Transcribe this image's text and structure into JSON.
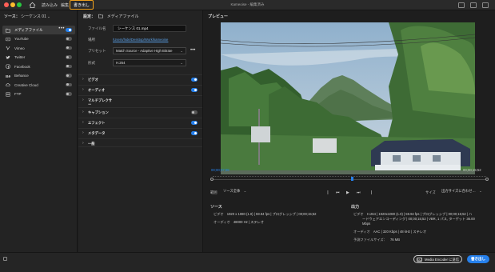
{
  "titlebar": {
    "tabs": [
      {
        "label": "読み込み"
      },
      {
        "label": "編集"
      },
      {
        "label": "書き出し"
      }
    ],
    "app_title": "Kameoise - 編集済み"
  },
  "left": {
    "source_label": "ソース：",
    "source_value": "シーケンス 01",
    "destinations": [
      {
        "label": "メディアファイル",
        "enabled": true
      },
      {
        "label": "YouTube",
        "enabled": false
      },
      {
        "label": "Vimeo",
        "enabled": false
      },
      {
        "label": "Twitter",
        "enabled": false
      },
      {
        "label": "Facebook",
        "enabled": false
      },
      {
        "label": "Behance",
        "enabled": false
      },
      {
        "label": "Creative Cloud",
        "enabled": false
      },
      {
        "label": "FTP",
        "enabled": false
      }
    ]
  },
  "settings": {
    "header": "設定：",
    "header_target": "メディアファイル",
    "filename_label": "ファイル名",
    "filename_value": "シーケンス 01.mp4",
    "location_label": "場所",
    "location_value": "/Users/hide/Desktop/Work/kameoise",
    "preset_label": "プリセット",
    "preset_value": "Match Source - Adaptive High Bitrate",
    "format_label": "形式",
    "format_value": "H.264",
    "sections": [
      {
        "label": "ビデオ",
        "toggle": "on"
      },
      {
        "label": "オーディオ",
        "toggle": "on"
      },
      {
        "label": "マルチプレクサー",
        "toggle": "none"
      },
      {
        "label": "キャプション",
        "toggle": "off"
      },
      {
        "label": "エフェクト",
        "toggle": "on"
      },
      {
        "label": "メタデータ",
        "toggle": "on"
      },
      {
        "label": "一般",
        "toggle": "none"
      }
    ]
  },
  "preview": {
    "title": "プレビュー",
    "current_tc": "00;00;07;08",
    "end_tc": "00;00;15;52",
    "range_label": "範囲",
    "range_value": "ソース全体",
    "size_label": "サイズ",
    "size_value": "出力サイズに合わせ…"
  },
  "source_info": {
    "title": "ソース",
    "video_key": "ビデオ",
    "video_val": "1920 x 1080 (1.0)  |  59.94 fps  |  プログレッシブ  |  00;00;15;52",
    "audio_key": "オーディオ",
    "audio_val": "48000 Hz  |  ステレオ"
  },
  "output_info": {
    "title": "出力",
    "video_key": "ビデオ",
    "video_val_1": "H.264  |  1920x1080 (1.0)  |  59.94 fps  |  プログレッシブ  |  00;00;15;52  |  ハ",
    "video_val_2": "ードウェアエンコーディング  |  00;00;15;52  |  VBR, 1 パス, ターゲット 36.00",
    "video_val_3": "Mbps",
    "audio_key": "オーディオ",
    "audio_val": "AAC  |  320 Kbps  |  48 kHz  |  ステレオ",
    "size_key": "予測ファイルサイズ：",
    "size_val": "76 MB"
  },
  "bottom": {
    "me_button": "Media Encoder に送信",
    "me_icon_text": "Me",
    "export_button": "書き出し"
  },
  "colors": {
    "accent": "#2680eb",
    "active_tab_outline": "#f0a11c"
  }
}
